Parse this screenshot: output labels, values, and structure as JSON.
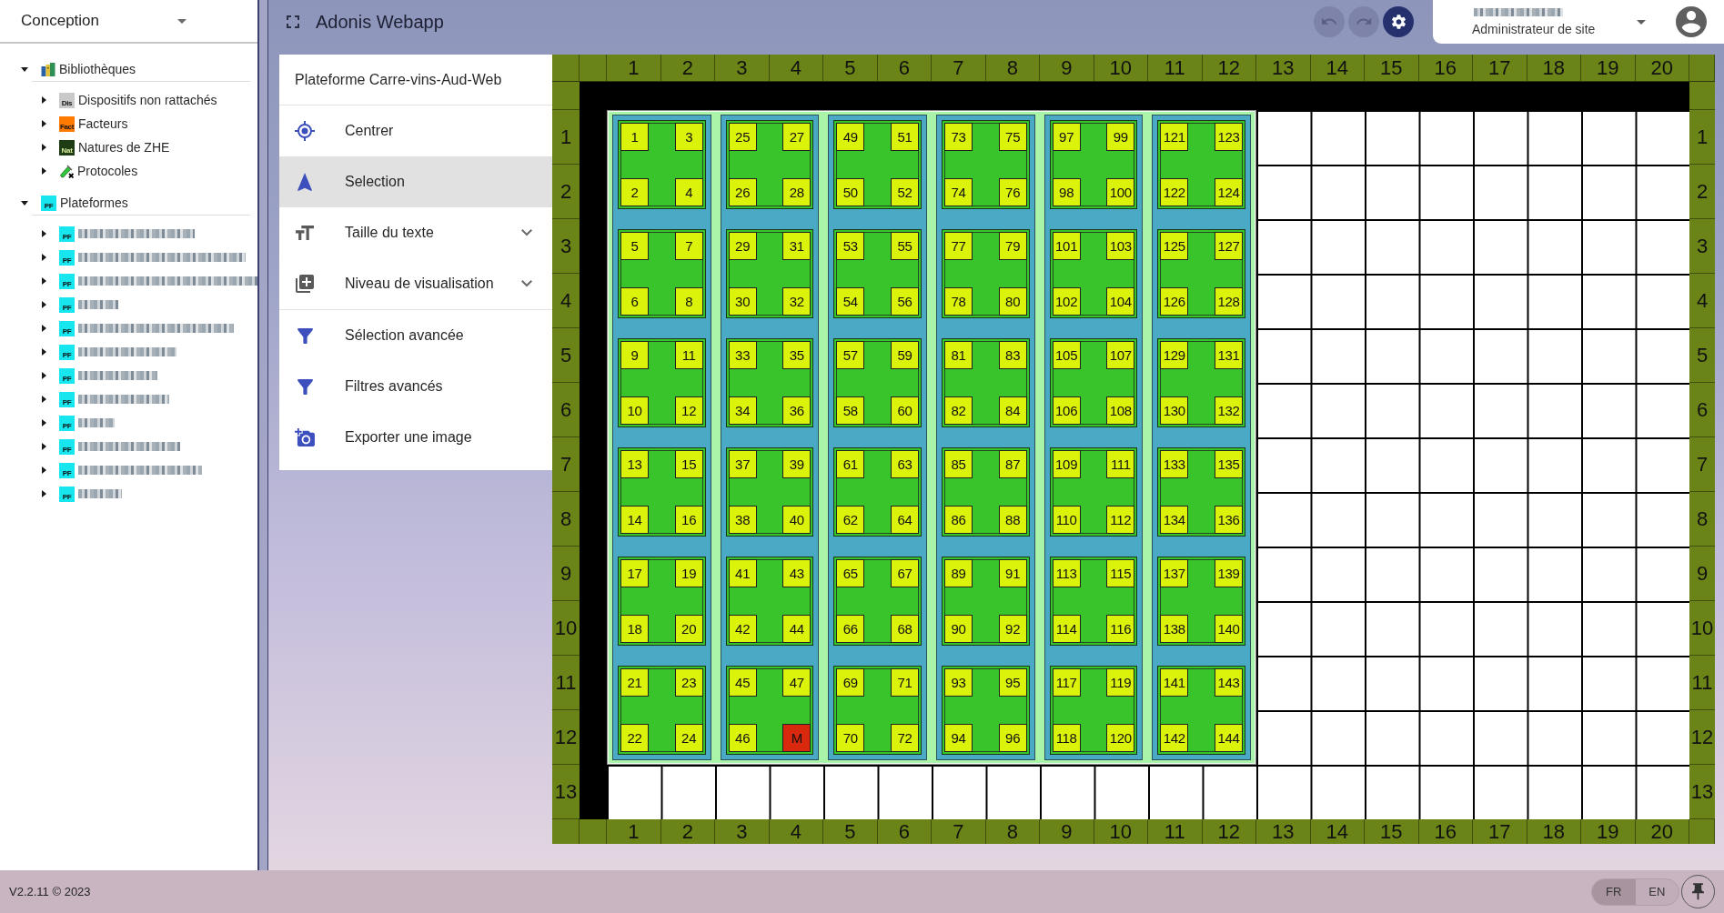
{
  "sidebar": {
    "mode": {
      "value": "Conception"
    },
    "tree": [
      {
        "label": "Bibliothèques",
        "kind": "libraries",
        "expanded": true,
        "children": [
          {
            "label": "Dispositifs non rattachés",
            "kind": "library",
            "badge": "Dis",
            "color": "#c9c9c9",
            "expanded": false
          },
          {
            "label": "Facteurs",
            "kind": "library",
            "badge": "Fact",
            "color": "#ff7a00",
            "expanded": false
          },
          {
            "label": "Natures de ZHE",
            "kind": "library",
            "badge": "Nat",
            "color": "#1e3d14",
            "expanded": false
          },
          {
            "label": "Protocoles",
            "kind": "protocols",
            "expanded": false
          }
        ]
      },
      {
        "label": "Plateformes",
        "kind": "platforms",
        "badge": "PF",
        "color": "#17e6ee",
        "expanded": true,
        "children": [
          {
            "kind": "platform",
            "badge": "PF",
            "color": "#17e6ee",
            "expanded": false,
            "redacted": true
          },
          {
            "kind": "platform",
            "badge": "PF",
            "color": "#17e6ee",
            "expanded": false,
            "redacted": true
          },
          {
            "kind": "platform",
            "badge": "PF",
            "color": "#17e6ee",
            "expanded": false,
            "redacted": true
          },
          {
            "kind": "platform",
            "badge": "PF",
            "color": "#17e6ee",
            "expanded": false,
            "redacted": true
          },
          {
            "kind": "platform",
            "badge": "PF",
            "color": "#17e6ee",
            "expanded": false,
            "redacted": true
          },
          {
            "kind": "platform",
            "badge": "PF",
            "color": "#17e6ee",
            "expanded": false,
            "redacted": true
          },
          {
            "kind": "platform",
            "badge": "PF",
            "color": "#17e6ee",
            "expanded": false,
            "redacted": true
          },
          {
            "kind": "platform",
            "badge": "PF",
            "color": "#17e6ee",
            "expanded": false,
            "redacted": true
          },
          {
            "kind": "platform",
            "badge": "PF",
            "color": "#17e6ee",
            "expanded": false,
            "redacted": true
          },
          {
            "kind": "platform",
            "badge": "PF",
            "color": "#17e6ee",
            "expanded": false,
            "redacted": true
          },
          {
            "kind": "platform",
            "badge": "PF",
            "color": "#17e6ee",
            "expanded": false,
            "redacted": true
          },
          {
            "kind": "platform",
            "badge": "PF",
            "color": "#17e6ee",
            "expanded": false,
            "redacted": true
          }
        ]
      }
    ]
  },
  "header": {
    "title": "Adonis Webapp",
    "actions": [
      {
        "kind": "undo",
        "disabled": true
      },
      {
        "kind": "redo",
        "disabled": true
      },
      {
        "kind": "settings",
        "disabled": false
      }
    ],
    "user": {
      "name_redacted": true,
      "role": "Administrateur de site"
    }
  },
  "menu": {
    "title": "Plateforme Carre-vins-Aud-Web",
    "sections": [
      [
        {
          "label": "Centrer",
          "kind": "action",
          "selected": false
        },
        {
          "label": "Selection",
          "kind": "action",
          "selected": true
        },
        {
          "label": "Taille du texte",
          "kind": "submenu",
          "selected": false
        },
        {
          "label": "Niveau de visualisation",
          "kind": "submenu",
          "selected": false
        }
      ],
      [
        {
          "label": "Sélection avancée",
          "kind": "action",
          "selected": false
        },
        {
          "label": "Filtres avancés",
          "kind": "action",
          "selected": false
        },
        {
          "label": "Exporter une image",
          "kind": "action",
          "selected": false
        }
      ]
    ]
  },
  "board": {
    "top_labels": [
      "1",
      "2",
      "3",
      "4",
      "5",
      "6",
      "7",
      "8",
      "9",
      "10",
      "11",
      "12",
      "13",
      "14",
      "15",
      "16",
      "17",
      "18",
      "19",
      "20"
    ],
    "left_labels": [
      "1",
      "2",
      "3",
      "4",
      "5",
      "6",
      "7",
      "8",
      "9",
      "10",
      "11",
      "12",
      "13"
    ],
    "platform": {
      "devices": [
        {
          "blocks": [
            {
              "plots": [
                {
                  "label": "1",
                  "color": "#dbf20b"
                },
                {
                  "label": "3",
                  "color": "#dbf20b"
                },
                {
                  "label": "2",
                  "color": "#dbf20b"
                },
                {
                  "label": "4",
                  "color": "#dbf20b"
                }
              ]
            },
            {
              "plots": [
                {
                  "label": "5",
                  "color": "#dbf20b"
                },
                {
                  "label": "7",
                  "color": "#dbf20b"
                },
                {
                  "label": "6",
                  "color": "#dbf20b"
                },
                {
                  "label": "8",
                  "color": "#dbf20b"
                }
              ]
            },
            {
              "plots": [
                {
                  "label": "9",
                  "color": "#dbf20b"
                },
                {
                  "label": "11",
                  "color": "#dbf20b"
                },
                {
                  "label": "10",
                  "color": "#dbf20b"
                },
                {
                  "label": "12",
                  "color": "#dbf20b"
                }
              ]
            },
            {
              "plots": [
                {
                  "label": "13",
                  "color": "#dbf20b"
                },
                {
                  "label": "15",
                  "color": "#dbf20b"
                },
                {
                  "label": "14",
                  "color": "#dbf20b"
                },
                {
                  "label": "16",
                  "color": "#dbf20b"
                }
              ]
            },
            {
              "plots": [
                {
                  "label": "17",
                  "color": "#dbf20b"
                },
                {
                  "label": "19",
                  "color": "#dbf20b"
                },
                {
                  "label": "18",
                  "color": "#dbf20b"
                },
                {
                  "label": "20",
                  "color": "#dbf20b"
                }
              ]
            },
            {
              "plots": [
                {
                  "label": "21",
                  "color": "#dbf20b"
                },
                {
                  "label": "23",
                  "color": "#dbf20b"
                },
                {
                  "label": "22",
                  "color": "#dbf20b"
                },
                {
                  "label": "24",
                  "color": "#dbf20b"
                }
              ]
            }
          ]
        },
        {
          "blocks": [
            {
              "plots": [
                {
                  "label": "25",
                  "color": "#dbf20b"
                },
                {
                  "label": "27",
                  "color": "#dbf20b"
                },
                {
                  "label": "26",
                  "color": "#dbf20b"
                },
                {
                  "label": "28",
                  "color": "#dbf20b"
                }
              ]
            },
            {
              "plots": [
                {
                  "label": "29",
                  "color": "#dbf20b"
                },
                {
                  "label": "31",
                  "color": "#dbf20b"
                },
                {
                  "label": "30",
                  "color": "#dbf20b"
                },
                {
                  "label": "32",
                  "color": "#dbf20b"
                }
              ]
            },
            {
              "plots": [
                {
                  "label": "33",
                  "color": "#dbf20b"
                },
                {
                  "label": "35",
                  "color": "#dbf20b"
                },
                {
                  "label": "34",
                  "color": "#dbf20b"
                },
                {
                  "label": "36",
                  "color": "#dbf20b"
                }
              ]
            },
            {
              "plots": [
                {
                  "label": "37",
                  "color": "#dbf20b"
                },
                {
                  "label": "39",
                  "color": "#dbf20b"
                },
                {
                  "label": "38",
                  "color": "#dbf20b"
                },
                {
                  "label": "40",
                  "color": "#dbf20b"
                }
              ]
            },
            {
              "plots": [
                {
                  "label": "41",
                  "color": "#dbf20b"
                },
                {
                  "label": "43",
                  "color": "#dbf20b"
                },
                {
                  "label": "42",
                  "color": "#dbf20b"
                },
                {
                  "label": "44",
                  "color": "#dbf20b"
                }
              ]
            },
            {
              "plots": [
                {
                  "label": "45",
                  "color": "#dbf20b"
                },
                {
                  "label": "47",
                  "color": "#dbf20b"
                },
                {
                  "label": "46",
                  "color": "#dbf20b"
                },
                {
                  "label": "M",
                  "color": "#d8290e"
                }
              ]
            }
          ]
        },
        {
          "blocks": [
            {
              "plots": [
                {
                  "label": "49",
                  "color": "#dbf20b"
                },
                {
                  "label": "51",
                  "color": "#dbf20b"
                },
                {
                  "label": "50",
                  "color": "#dbf20b"
                },
                {
                  "label": "52",
                  "color": "#dbf20b"
                }
              ]
            },
            {
              "plots": [
                {
                  "label": "53",
                  "color": "#dbf20b"
                },
                {
                  "label": "55",
                  "color": "#dbf20b"
                },
                {
                  "label": "54",
                  "color": "#dbf20b"
                },
                {
                  "label": "56",
                  "color": "#dbf20b"
                }
              ]
            },
            {
              "plots": [
                {
                  "label": "57",
                  "color": "#dbf20b"
                },
                {
                  "label": "59",
                  "color": "#dbf20b"
                },
                {
                  "label": "58",
                  "color": "#dbf20b"
                },
                {
                  "label": "60",
                  "color": "#dbf20b"
                }
              ]
            },
            {
              "plots": [
                {
                  "label": "61",
                  "color": "#dbf20b"
                },
                {
                  "label": "63",
                  "color": "#dbf20b"
                },
                {
                  "label": "62",
                  "color": "#dbf20b"
                },
                {
                  "label": "64",
                  "color": "#dbf20b"
                }
              ]
            },
            {
              "plots": [
                {
                  "label": "65",
                  "color": "#dbf20b"
                },
                {
                  "label": "67",
                  "color": "#dbf20b"
                },
                {
                  "label": "66",
                  "color": "#dbf20b"
                },
                {
                  "label": "68",
                  "color": "#dbf20b"
                }
              ]
            },
            {
              "plots": [
                {
                  "label": "69",
                  "color": "#dbf20b"
                },
                {
                  "label": "71",
                  "color": "#dbf20b"
                },
                {
                  "label": "70",
                  "color": "#dbf20b"
                },
                {
                  "label": "72",
                  "color": "#dbf20b"
                }
              ]
            }
          ]
        },
        {
          "blocks": [
            {
              "plots": [
                {
                  "label": "73",
                  "color": "#dbf20b"
                },
                {
                  "label": "75",
                  "color": "#dbf20b"
                },
                {
                  "label": "74",
                  "color": "#dbf20b"
                },
                {
                  "label": "76",
                  "color": "#dbf20b"
                }
              ]
            },
            {
              "plots": [
                {
                  "label": "77",
                  "color": "#dbf20b"
                },
                {
                  "label": "79",
                  "color": "#dbf20b"
                },
                {
                  "label": "78",
                  "color": "#dbf20b"
                },
                {
                  "label": "80",
                  "color": "#dbf20b"
                }
              ]
            },
            {
              "plots": [
                {
                  "label": "81",
                  "color": "#dbf20b"
                },
                {
                  "label": "83",
                  "color": "#dbf20b"
                },
                {
                  "label": "82",
                  "color": "#dbf20b"
                },
                {
                  "label": "84",
                  "color": "#dbf20b"
                }
              ]
            },
            {
              "plots": [
                {
                  "label": "85",
                  "color": "#dbf20b"
                },
                {
                  "label": "87",
                  "color": "#dbf20b"
                },
                {
                  "label": "86",
                  "color": "#dbf20b"
                },
                {
                  "label": "88",
                  "color": "#dbf20b"
                }
              ]
            },
            {
              "plots": [
                {
                  "label": "89",
                  "color": "#dbf20b"
                },
                {
                  "label": "91",
                  "color": "#dbf20b"
                },
                {
                  "label": "90",
                  "color": "#dbf20b"
                },
                {
                  "label": "92",
                  "color": "#dbf20b"
                }
              ]
            },
            {
              "plots": [
                {
                  "label": "93",
                  "color": "#dbf20b"
                },
                {
                  "label": "95",
                  "color": "#dbf20b"
                },
                {
                  "label": "94",
                  "color": "#dbf20b"
                },
                {
                  "label": "96",
                  "color": "#dbf20b"
                }
              ]
            }
          ]
        },
        {
          "blocks": [
            {
              "plots": [
                {
                  "label": "97",
                  "color": "#dbf20b"
                },
                {
                  "label": "99",
                  "color": "#dbf20b"
                },
                {
                  "label": "98",
                  "color": "#dbf20b"
                },
                {
                  "label": "100",
                  "color": "#dbf20b"
                }
              ]
            },
            {
              "plots": [
                {
                  "label": "101",
                  "color": "#dbf20b"
                },
                {
                  "label": "103",
                  "color": "#dbf20b"
                },
                {
                  "label": "102",
                  "color": "#dbf20b"
                },
                {
                  "label": "104",
                  "color": "#dbf20b"
                }
              ]
            },
            {
              "plots": [
                {
                  "label": "105",
                  "color": "#dbf20b"
                },
                {
                  "label": "107",
                  "color": "#dbf20b"
                },
                {
                  "label": "106",
                  "color": "#dbf20b"
                },
                {
                  "label": "108",
                  "color": "#dbf20b"
                }
              ]
            },
            {
              "plots": [
                {
                  "label": "109",
                  "color": "#dbf20b"
                },
                {
                  "label": "111",
                  "color": "#dbf20b"
                },
                {
                  "label": "110",
                  "color": "#dbf20b"
                },
                {
                  "label": "112",
                  "color": "#dbf20b"
                }
              ]
            },
            {
              "plots": [
                {
                  "label": "113",
                  "color": "#dbf20b"
                },
                {
                  "label": "115",
                  "color": "#dbf20b"
                },
                {
                  "label": "114",
                  "color": "#dbf20b"
                },
                {
                  "label": "116",
                  "color": "#dbf20b"
                }
              ]
            },
            {
              "plots": [
                {
                  "label": "117",
                  "color": "#dbf20b"
                },
                {
                  "label": "119",
                  "color": "#dbf20b"
                },
                {
                  "label": "118",
                  "color": "#dbf20b"
                },
                {
                  "label": "120",
                  "color": "#dbf20b"
                }
              ]
            }
          ]
        },
        {
          "blocks": [
            {
              "plots": [
                {
                  "label": "121",
                  "color": "#dbf20b"
                },
                {
                  "label": "123",
                  "color": "#dbf20b"
                },
                {
                  "label": "122",
                  "color": "#dbf20b"
                },
                {
                  "label": "124",
                  "color": "#dbf20b"
                }
              ]
            },
            {
              "plots": [
                {
                  "label": "125",
                  "color": "#dbf20b"
                },
                {
                  "label": "127",
                  "color": "#dbf20b"
                },
                {
                  "label": "126",
                  "color": "#dbf20b"
                },
                {
                  "label": "128",
                  "color": "#dbf20b"
                }
              ]
            },
            {
              "plots": [
                {
                  "label": "129",
                  "color": "#dbf20b"
                },
                {
                  "label": "131",
                  "color": "#dbf20b"
                },
                {
                  "label": "130",
                  "color": "#dbf20b"
                },
                {
                  "label": "132",
                  "color": "#dbf20b"
                }
              ]
            },
            {
              "plots": [
                {
                  "label": "133",
                  "color": "#dbf20b"
                },
                {
                  "label": "135",
                  "color": "#dbf20b"
                },
                {
                  "label": "134",
                  "color": "#dbf20b"
                },
                {
                  "label": "136",
                  "color": "#dbf20b"
                }
              ]
            },
            {
              "plots": [
                {
                  "label": "137",
                  "color": "#dbf20b"
                },
                {
                  "label": "139",
                  "color": "#dbf20b"
                },
                {
                  "label": "138",
                  "color": "#dbf20b"
                },
                {
                  "label": "140",
                  "color": "#dbf20b"
                }
              ]
            },
            {
              "plots": [
                {
                  "label": "141",
                  "color": "#dbf20b"
                },
                {
                  "label": "143",
                  "color": "#dbf20b"
                },
                {
                  "label": "142",
                  "color": "#dbf20b"
                },
                {
                  "label": "144",
                  "color": "#dbf20b"
                }
              ]
            }
          ]
        }
      ]
    },
    "right_labels": [
      "1",
      "2",
      "3",
      "4",
      "5",
      "6",
      "7",
      "8",
      "9",
      "10",
      "11",
      "12",
      "13"
    ],
    "bottom_labels": [
      "1",
      "2",
      "3",
      "4",
      "5",
      "6",
      "7",
      "8",
      "9",
      "10",
      "11",
      "12",
      "13",
      "14",
      "15",
      "16",
      "17",
      "18",
      "19",
      "20"
    ]
  },
  "footer": {
    "version": "V2.2.11 © 2023",
    "languages": [
      {
        "label": "FR",
        "selected": true
      },
      {
        "label": "EN",
        "selected": false
      }
    ]
  }
}
